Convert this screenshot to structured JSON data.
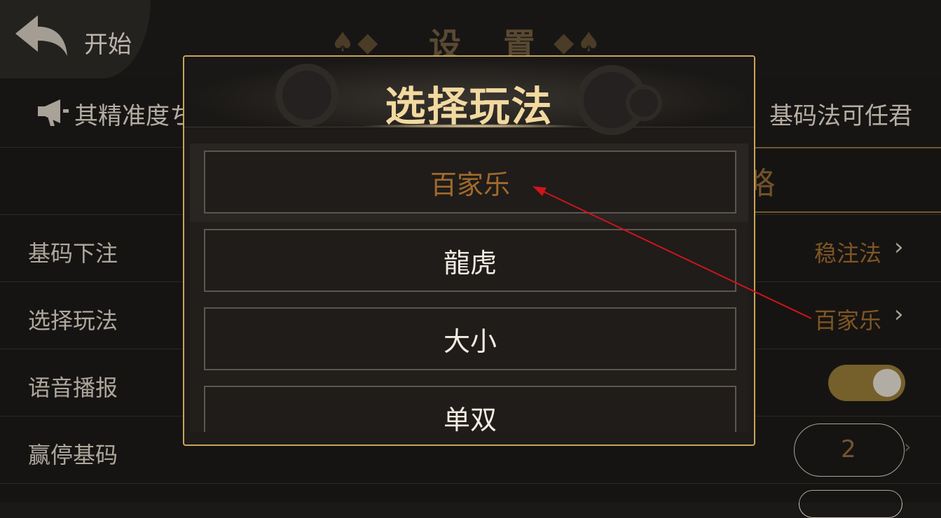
{
  "header": {
    "back_label": "开始",
    "title": "设 置",
    "suits_left": "♠◆",
    "suits_right": "◆♠"
  },
  "marquee": {
    "left_text": "其精准度ち",
    "right_text": "基码法可任君"
  },
  "strategy": {
    "partial_text": "略"
  },
  "rows": [
    {
      "label": "基码下注",
      "value": "稳注法",
      "chevron": "›"
    },
    {
      "label": "选择玩法",
      "value": "百家乐",
      "chevron": "›"
    },
    {
      "label": "语音播报",
      "toggle_on": true
    },
    {
      "label": "赢停基码",
      "value": "2",
      "chevron": "›"
    }
  ],
  "modal": {
    "title": "选择玩法",
    "options": [
      {
        "label": "百家乐",
        "selected": true
      },
      {
        "label": "龍虎",
        "selected": false
      },
      {
        "label": "大小",
        "selected": false
      },
      {
        "label": "单双",
        "selected": false
      }
    ]
  },
  "colors": {
    "accent_gold": "#c9a45a",
    "selected_text": "#a06a2c",
    "annotation_arrow": "#d0141a"
  },
  "icons": {
    "back": "back-arrow-icon",
    "speaker": "megaphone-icon",
    "chevron": "chevron-right-icon"
  }
}
